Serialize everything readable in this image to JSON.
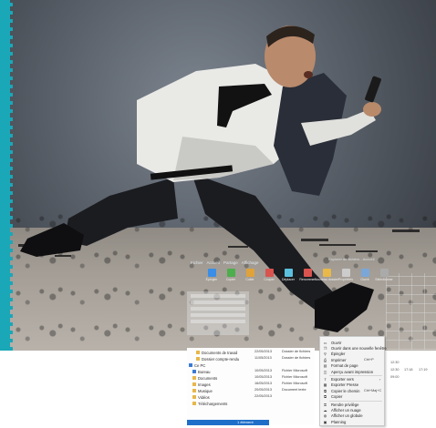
{
  "app": {
    "title_faint": "Explorer de fichiers - Accueil",
    "ribbon_tabs": [
      "Fichier",
      "Accueil",
      "Partage",
      "Affichage"
    ],
    "ribbon_buttons": [
      {
        "label": "Épingler",
        "color": "#3a8ee6"
      },
      {
        "label": "Copier",
        "color": "#4cae4c"
      },
      {
        "label": "Coller",
        "color": "#e0a23a"
      },
      {
        "label": "Couper",
        "color": "#d9534f"
      },
      {
        "label": "Déplacer",
        "color": "#5bc0de"
      },
      {
        "label": "Renommer",
        "color": "#d9534f"
      },
      {
        "label": "Nouveau dossier",
        "color": "#e8b84a"
      },
      {
        "label": "Propriétés",
        "color": "#cccccc"
      },
      {
        "label": "Ouvrir",
        "color": "#7aa7d8"
      },
      {
        "label": "Sélectionner",
        "color": "#aaaaaa"
      }
    ]
  },
  "file_list": {
    "rows": [
      {
        "name": "Documents de travail",
        "icon": "folder-icon",
        "date": "22/05/2013",
        "type": "Dossier de fichiers"
      },
      {
        "name": "Dossier compte-rendu",
        "icon": "folder-icon",
        "date": "11/05/2013",
        "type": "Dossier de fichiers"
      },
      {
        "name": "Ce PC",
        "icon": "computer-icon",
        "date": "",
        "type": ""
      },
      {
        "name": "Bureau",
        "icon": "desktop-icon",
        "date": "10/05/2013",
        "type": "Fichier Microsoft"
      },
      {
        "name": "Documents",
        "icon": "folder-icon",
        "date": "10/05/2013",
        "type": "Fichier Microsoft"
      },
      {
        "name": "Images",
        "icon": "folder-icon",
        "date": "16/05/2013",
        "type": "Fichier Microsoft"
      },
      {
        "name": "Musique",
        "icon": "folder-icon",
        "date": "20/05/2013",
        "type": "Document texte"
      },
      {
        "name": "Vidéos",
        "icon": "folder-icon",
        "date": "22/05/2013",
        "type": ""
      },
      {
        "name": "Téléchargements",
        "icon": "folder-icon",
        "date": "",
        "type": ""
      }
    ],
    "status": "1 élément sélectionné"
  },
  "context_menu": {
    "items": [
      {
        "label": "Ouvrir",
        "icon": "open-icon",
        "shortcut": "",
        "submenu": false
      },
      {
        "label": "Ouvrir dans une nouvelle fenêtre",
        "icon": "window-icon",
        "shortcut": "",
        "submenu": false
      },
      {
        "label": "Épingler",
        "icon": "pin-icon",
        "shortcut": "",
        "submenu": false
      },
      {
        "label": "Imprimer",
        "icon": "print-icon",
        "shortcut": "Ctrl+P",
        "submenu": false
      },
      {
        "label": "Format de page",
        "icon": "page-icon",
        "shortcut": "",
        "submenu": false
      },
      {
        "label": "Aperçu avant impression",
        "icon": "preview-icon",
        "shortcut": "",
        "submenu": false
      },
      {
        "label": "Exporter vers",
        "icon": "export-icon",
        "shortcut": "",
        "submenu": true
      },
      {
        "label": "Exporter Presse",
        "icon": "press-icon",
        "shortcut": "",
        "submenu": false
      },
      {
        "label": "Copier le chemin",
        "icon": "copy-icon",
        "shortcut": "Ctrl+Maj+C",
        "submenu": false
      },
      {
        "label": "Copier",
        "icon": "copy2-icon",
        "shortcut": "",
        "submenu": false
      },
      {
        "label": "Rendre privilège",
        "icon": "lock-icon",
        "shortcut": "",
        "submenu": false
      },
      {
        "label": "Afficher un nuage",
        "icon": "cloud-icon",
        "shortcut": "",
        "submenu": false
      },
      {
        "label": "Afficher un globule",
        "icon": "globe-icon",
        "shortcut": "",
        "submenu": false
      },
      {
        "label": "Planning",
        "icon": "calendar-icon",
        "shortcut": "",
        "submenu": false
      }
    ]
  },
  "details": {
    "cells": [
      "12:30",
      "12:30",
      "17:18",
      "17:19",
      "09:00"
    ]
  }
}
